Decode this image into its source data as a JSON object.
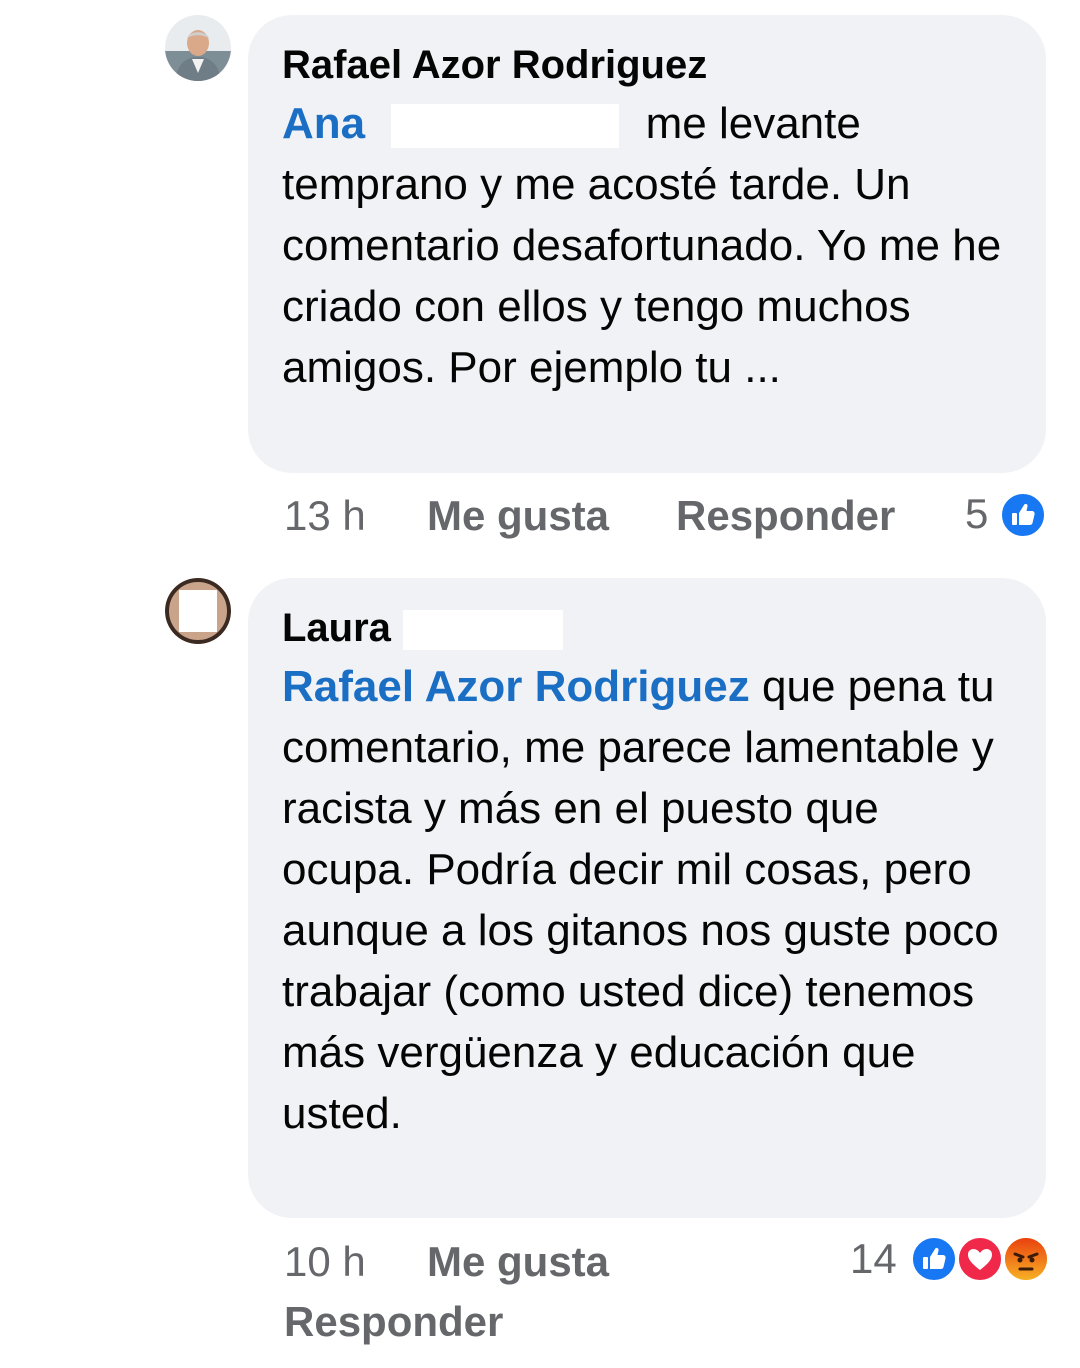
{
  "comments": [
    {
      "author": "Rafael Azor Rodriguez",
      "mention": "Ana",
      "text_line1": "me levante",
      "text_rest": "temprano y me acosté tarde. Un comentario desafortunado. Yo me he criado con ellos y tengo muchos amigos. Por ejemplo tu ...",
      "time": "13 h",
      "like_label": "Me gusta",
      "reply_label": "Responder",
      "reaction_count": "5",
      "reactions": [
        "like-icon"
      ]
    },
    {
      "author": "Laura",
      "mention": "Rafael Azor Rodriguez",
      "text": "que pena tu comentario, me parece lamentable y racista y más en el puesto que ocupa. Podría decir mil cosas, pero aunque a los gitanos nos guste poco trabajar (como usted dice) tenemos más vergüenza y educación que usted.",
      "time": "10 h",
      "like_label": "Me gusta",
      "reply_label": "Responder",
      "reaction_count": "14",
      "reactions": [
        "like-icon",
        "love-icon",
        "angry-icon"
      ]
    }
  ],
  "colors": {
    "bubble": "#f0f2f5",
    "mention": "#1a6fc4",
    "secondary_text": "#65676b",
    "like": "#1877f2",
    "love": "#f0284a",
    "angry": "#e9710f"
  }
}
